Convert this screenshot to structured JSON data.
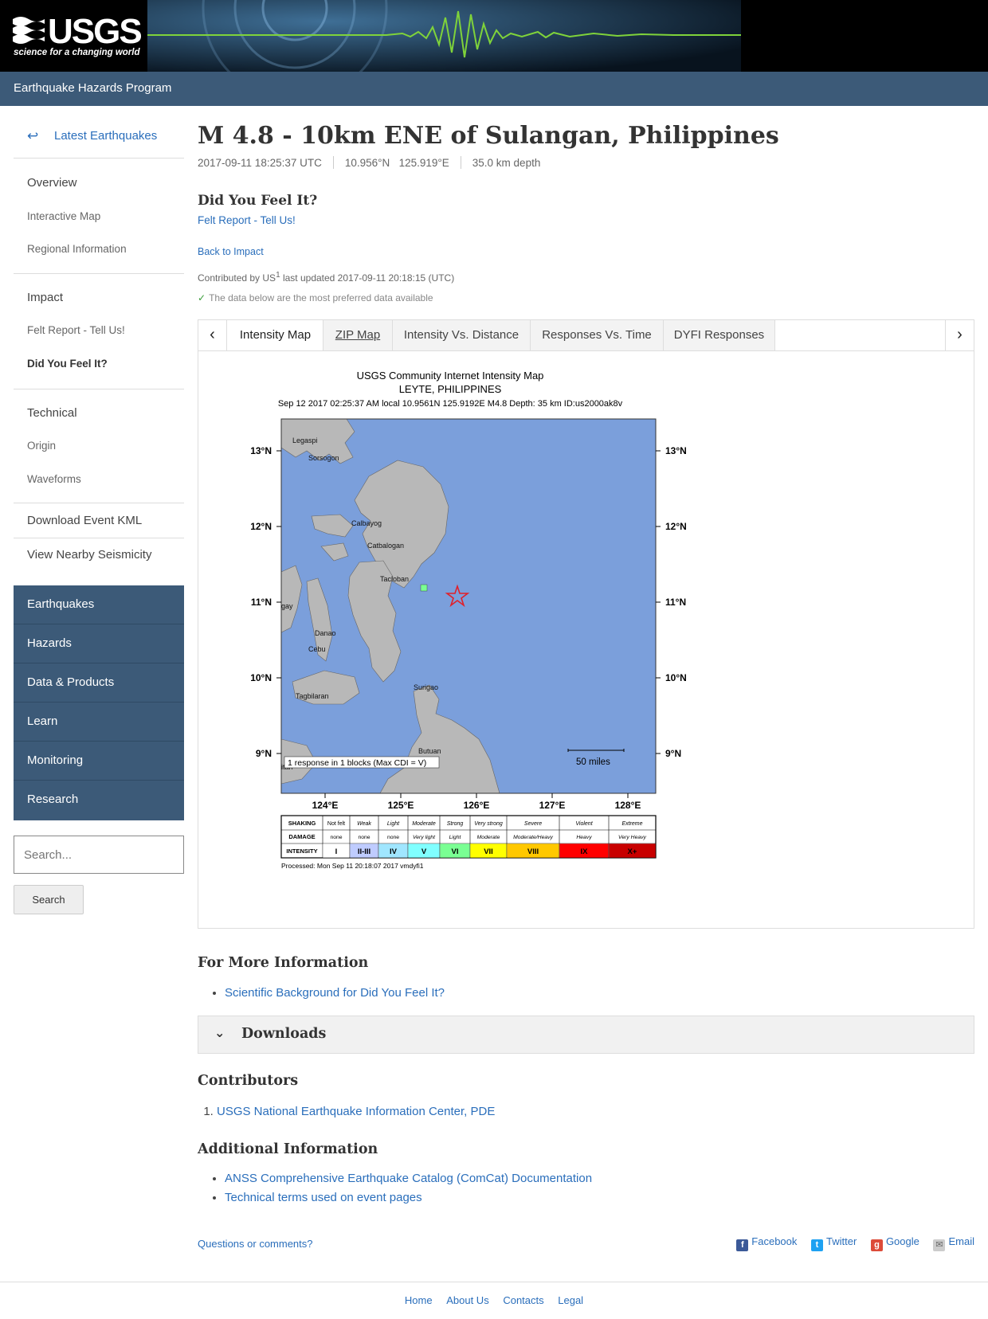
{
  "header": {
    "logo_text": "USGS",
    "logo_tagline": "science for a changing world",
    "program_title": "Earthquake Hazards Program"
  },
  "sidebar": {
    "back_label": "Latest Earthquakes",
    "back_arrow": "↩",
    "overview": "Overview",
    "interactive_map": "Interactive Map",
    "regional_info": "Regional Information",
    "impact": "Impact",
    "felt_report": "Felt Report - Tell Us!",
    "dyfi": "Did You Feel It?",
    "technical": "Technical",
    "origin": "Origin",
    "waveforms": "Waveforms",
    "download_kml": "Download Event KML",
    "nearby_seismicity": "View Nearby Seismicity",
    "site_nav": [
      "Earthquakes",
      "Hazards",
      "Data & Products",
      "Learn",
      "Monitoring",
      "Research"
    ],
    "search_placeholder": "Search...",
    "search_button": "Search"
  },
  "event": {
    "title": "M 4.8 - 10km ENE of Sulangan, Philippines",
    "time": "2017-09-11 18:25:37 UTC",
    "lat": "10.956°N",
    "lon": "125.919°E",
    "depth": "35.0 km depth"
  },
  "page": {
    "section_title": "Did You Feel It?",
    "felt_link": "Felt Report - Tell Us!",
    "back_link": "Back to Impact",
    "contrib_prefix": "Contributed by US",
    "contrib_sup": "1",
    "contrib_suffix": " last updated 2017-09-11 20:18:15 (UTC)",
    "preferred_check": "✓",
    "preferred_note": "The data below are the most preferred data available"
  },
  "tabs": {
    "prev": "‹",
    "next": "›",
    "items": [
      "Intensity Map",
      "ZIP Map",
      "Intensity Vs. Distance",
      "Responses Vs. Time",
      "DYFI Responses"
    ]
  },
  "map": {
    "title_line1": "USGS Community Internet Intensity Map",
    "title_line2": "LEYTE, PHILIPPINES",
    "title_line3": "Sep 12 2017 02:25:37 AM local 10.9561N 125.9192E M4.8 Depth: 35 km ID:us2000ak8v",
    "lat_labels": [
      "13°N",
      "12°N",
      "11°N",
      "10°N",
      "9°N"
    ],
    "lon_labels": [
      "124°E",
      "125°E",
      "126°E",
      "127°E",
      "128°E"
    ],
    "places": [
      "Legaspi",
      "Sorsogon",
      "Calbayog",
      "Catbalogan",
      "Tacloban",
      "Danao",
      "Cebu",
      "Surigao",
      "Tagbilaran",
      "Butuan",
      "gay",
      "itan"
    ],
    "response_note": "1 response in 1 blocks (Max CDI = V)",
    "scale_label": "50 miles",
    "legend_rows": [
      "SHAKING",
      "DAMAGE",
      "INTENSITY"
    ],
    "shaking": [
      "Not felt",
      "Weak",
      "Light",
      "Moderate",
      "Strong",
      "Very strong",
      "Severe",
      "Violent",
      "Extreme"
    ],
    "damage": [
      "none",
      "none",
      "none",
      "Very light",
      "Light",
      "Moderate",
      "Moderate/Heavy",
      "Heavy",
      "Very Heavy"
    ],
    "intensity": [
      "I",
      "II-III",
      "IV",
      "V",
      "VI",
      "VII",
      "VIII",
      "IX",
      "X+"
    ],
    "intensity_colors": [
      "#ffffff",
      "#bfccff",
      "#a0e6ff",
      "#80ffff",
      "#7aff93",
      "#ffff00",
      "#ffc800",
      "#ff9100",
      "#ff0000",
      "#c80000"
    ],
    "processed": "Processed: Mon Sep 11 20:18:07 2017 vmdyfi1"
  },
  "more_info": {
    "title": "For More Information",
    "links": [
      "Scientific Background for Did You Feel It?"
    ]
  },
  "downloads": {
    "chevron": "⌄",
    "title": "Downloads"
  },
  "contributors": {
    "title": "Contributors",
    "items": [
      "USGS National Earthquake Information Center, PDE"
    ]
  },
  "additional": {
    "title": "Additional Information",
    "links": [
      "ANSS Comprehensive Earthquake Catalog (ComCat) Documentation",
      "Technical terms used on event pages"
    ]
  },
  "footer": {
    "questions": "Questions or comments?",
    "share": [
      "Facebook",
      "Twitter",
      "Google",
      "Email"
    ],
    "links": [
      "Home",
      "About Us",
      "Contacts",
      "Legal"
    ]
  },
  "colors": {
    "program_bar": "#3c5a78",
    "link": "#2a6ebb",
    "ocean": "#7b9fdb",
    "land": "#b8b8b8",
    "epicenter": "#e0202a",
    "response_block": "#7aff93"
  }
}
